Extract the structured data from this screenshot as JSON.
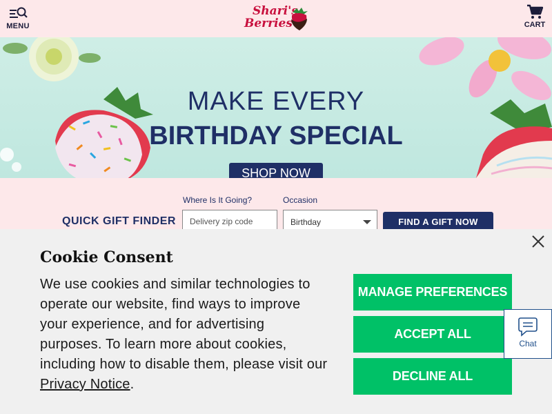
{
  "header": {
    "menu_label": "MENU",
    "cart_label": "CART",
    "logo_line1": "Shari's",
    "logo_line2": "Berries",
    "icons": [
      "search-icon",
      "menu-icon",
      "cart-icon"
    ]
  },
  "hero": {
    "line1": "MAKE EVERY",
    "line2": "BIRTHDAY SPECIAL",
    "cta_label": "SHOP NOW"
  },
  "gift_finder": {
    "title": "QUICK GIFT FINDER",
    "zip_label": "Where Is It Going?",
    "zip_placeholder": "Delivery zip code",
    "occasion_label": "Occasion",
    "occasion_selected": "Birthday",
    "submit_label": "FIND A GIFT NOW"
  },
  "cookie_consent": {
    "title": "Cookie Consent",
    "body": "We use cookies and similar technologies to operate our website, find ways to improve your experience, and for advertising purposes. To learn more about cookies, including how to disable them, please visit our ",
    "link_text": "Privacy Notice",
    "body_end": ".",
    "buttons": {
      "manage": "MANAGE PREFERENCES",
      "accept": "ACCEPT ALL",
      "decline": "DECLINE ALL"
    }
  },
  "chat": {
    "label": "Chat"
  },
  "colors": {
    "header_bg": "#fde8ea",
    "brand_navy": "#1f2f66",
    "brand_red": "#c8103e",
    "accept_green": "#00c167",
    "hero_bg": "#c8ece3"
  }
}
